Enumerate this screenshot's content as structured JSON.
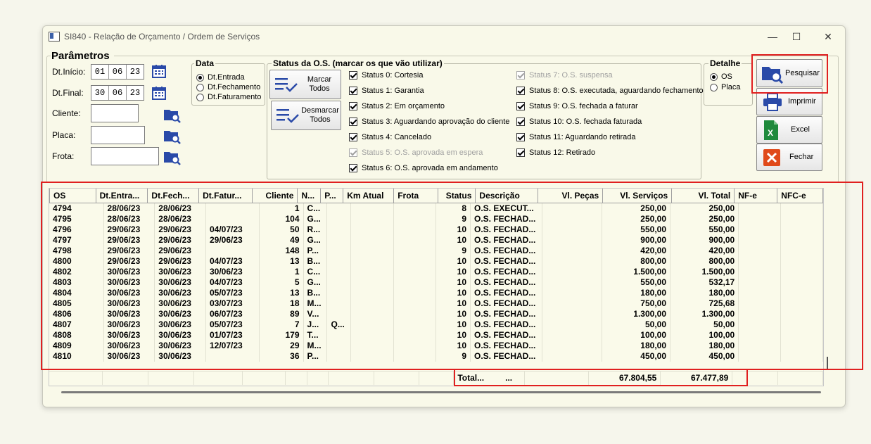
{
  "window": {
    "title": "SI840 - Relação de Orçamento / Ordem de Serviços",
    "minimize": "—",
    "maximize": "☐",
    "close": "✕"
  },
  "params": {
    "title": "Parâmetros",
    "dt_inicio_label": "Dt.Início:",
    "dt_inicio": [
      "01",
      "06",
      "23"
    ],
    "dt_final_label": "Dt.Final:",
    "dt_final": [
      "30",
      "06",
      "23"
    ],
    "cliente_label": "Cliente:",
    "placa_label": "Placa:",
    "frota_label": "Frota:"
  },
  "data_group": {
    "title": "Data",
    "options": [
      "Dt.Entrada",
      "Dt.Fechamento",
      "Dt.Faturamento"
    ],
    "selected": 0
  },
  "status_group": {
    "title": "Status da O.S. (marcar os que vão utilizar)",
    "marcar_label": "Marcar\nTodos",
    "desmarcar_label": "Desmarcar\nTodos",
    "col1": [
      {
        "label": "Status 0: Cortesia",
        "checked": true,
        "enabled": true
      },
      {
        "label": "Status 1: Garantia",
        "checked": true,
        "enabled": true
      },
      {
        "label": "Status 2: Em orçamento",
        "checked": true,
        "enabled": true
      },
      {
        "label": "Status 3: Aguardando aprovação do cliente",
        "checked": true,
        "enabled": true
      },
      {
        "label": "Status 4: Cancelado",
        "checked": true,
        "enabled": true
      },
      {
        "label": "Status 5: O.S. aprovada em espera",
        "checked": true,
        "enabled": false
      },
      {
        "label": "Status 6: O.S. aprovada em andamento",
        "checked": true,
        "enabled": true
      }
    ],
    "col2": [
      {
        "label": "Status 7: O.S. suspensa",
        "checked": true,
        "enabled": false
      },
      {
        "label": "Status 8: O.S. executada, aguardando fechamento",
        "checked": true,
        "enabled": true
      },
      {
        "label": "Status 9: O.S. fechada a faturar",
        "checked": true,
        "enabled": true
      },
      {
        "label": "Status 10: O.S. fechada faturada",
        "checked": true,
        "enabled": true
      },
      {
        "label": "Status 11: Aguardando retirada",
        "checked": true,
        "enabled": true
      },
      {
        "label": "Status 12: Retirado",
        "checked": true,
        "enabled": true
      }
    ]
  },
  "detalhe_group": {
    "title": "Detalhe",
    "options": [
      "OS",
      "Placa"
    ],
    "selected": 0
  },
  "actions": {
    "pesquisar": "Pesquisar",
    "imprimir": "Imprimir",
    "excel": "Excel",
    "fechar": "Fechar"
  },
  "grid": {
    "columns": [
      "OS",
      "Dt.Entra...",
      "Dt.Fech...",
      "Dt.Fatur...",
      "Cliente",
      "N...",
      "P...",
      "Km Atual",
      "Frota",
      "Status",
      "Descrição",
      "Vl. Peças",
      "Vl. Serviços",
      "Vl. Total",
      "NF-e",
      "NFC-e"
    ],
    "rows": [
      [
        "4794",
        "28/06/23",
        "28/06/23",
        "",
        "1",
        "C...",
        "",
        "",
        "",
        "8",
        "O.S. EXECUT...",
        "",
        "250,00",
        "250,00",
        "",
        ""
      ],
      [
        "4795",
        "28/06/23",
        "28/06/23",
        "",
        "104",
        "G...",
        "",
        "",
        "",
        "9",
        "O.S. FECHAD...",
        "",
        "250,00",
        "250,00",
        "",
        ""
      ],
      [
        "4796",
        "29/06/23",
        "29/06/23",
        "04/07/23",
        "50",
        "R...",
        "",
        "",
        "",
        "10",
        "O.S. FECHAD...",
        "",
        "550,00",
        "550,00",
        "",
        ""
      ],
      [
        "4797",
        "29/06/23",
        "29/06/23",
        "29/06/23",
        "49",
        "G...",
        "",
        "",
        "",
        "10",
        "O.S. FECHAD...",
        "",
        "900,00",
        "900,00",
        "",
        ""
      ],
      [
        "4798",
        "29/06/23",
        "29/06/23",
        "",
        "148",
        "P...",
        "",
        "",
        "",
        "9",
        "O.S. FECHAD...",
        "",
        "420,00",
        "420,00",
        "",
        ""
      ],
      [
        "4800",
        "29/06/23",
        "29/06/23",
        "04/07/23",
        "13",
        "B...",
        "",
        "",
        "",
        "10",
        "O.S. FECHAD...",
        "",
        "800,00",
        "800,00",
        "",
        ""
      ],
      [
        "4802",
        "30/06/23",
        "30/06/23",
        "30/06/23",
        "1",
        "C...",
        "",
        "",
        "",
        "10",
        "O.S. FECHAD...",
        "",
        "1.500,00",
        "1.500,00",
        "",
        ""
      ],
      [
        "4803",
        "30/06/23",
        "30/06/23",
        "04/07/23",
        "5",
        "G...",
        "",
        "",
        "",
        "10",
        "O.S. FECHAD...",
        "",
        "550,00",
        "532,17",
        "",
        ""
      ],
      [
        "4804",
        "30/06/23",
        "30/06/23",
        "05/07/23",
        "13",
        "B...",
        "",
        "",
        "",
        "10",
        "O.S. FECHAD...",
        "",
        "180,00",
        "180,00",
        "",
        ""
      ],
      [
        "4805",
        "30/06/23",
        "30/06/23",
        "03/07/23",
        "18",
        "M...",
        "",
        "",
        "",
        "10",
        "O.S. FECHAD...",
        "",
        "750,00",
        "725,68",
        "",
        ""
      ],
      [
        "4806",
        "30/06/23",
        "30/06/23",
        "06/07/23",
        "89",
        "V...",
        "",
        "",
        "",
        "10",
        "O.S. FECHAD...",
        "",
        "1.300,00",
        "1.300,00",
        "",
        ""
      ],
      [
        "4807",
        "30/06/23",
        "30/06/23",
        "05/07/23",
        "7",
        "J...",
        "Q...",
        "",
        "",
        "10",
        "O.S. FECHAD...",
        "",
        "50,00",
        "50,00",
        "",
        ""
      ],
      [
        "4808",
        "30/06/23",
        "30/06/23",
        "01/07/23",
        "179",
        "T...",
        "",
        "",
        "",
        "10",
        "O.S. FECHAD...",
        "",
        "100,00",
        "100,00",
        "",
        ""
      ],
      [
        "4809",
        "30/06/23",
        "30/06/23",
        "12/07/23",
        "29",
        "M...",
        "",
        "",
        "",
        "10",
        "O.S. FECHAD...",
        "",
        "180,00",
        "180,00",
        "",
        ""
      ],
      [
        "4810",
        "30/06/23",
        "30/06/23",
        "",
        "36",
        "P...",
        "",
        "",
        "",
        "9",
        "O.S. FECHAD...",
        "",
        "450,00",
        "450,00",
        "",
        ""
      ]
    ],
    "total_label": "Total...",
    "total_ellipsis": "...",
    "total_servicos": "67.804,55",
    "total_geral": "67.477,89"
  },
  "colors": {
    "background": "#f9f9e9",
    "highlight": "#e02020",
    "icon_blue": "#2a4aa8",
    "excel_green": "#1f8a3c",
    "close_red": "#e04a1a"
  }
}
